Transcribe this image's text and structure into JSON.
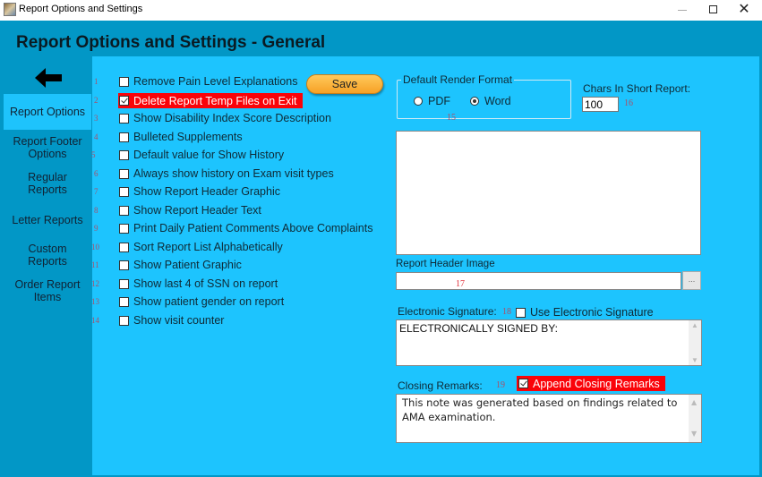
{
  "window": {
    "title": "Report Options and Settings",
    "controls": {
      "minimize": "—",
      "maximize": "□",
      "close": "✕"
    }
  },
  "header": {
    "title": "Report Options and Settings - General",
    "back_icon": "arrow-left-icon"
  },
  "sidebar": {
    "items": [
      {
        "label": "Report Options",
        "active": true
      },
      {
        "label": "Report Footer Options",
        "active": false
      },
      {
        "label": "Regular Reports",
        "active": false
      },
      {
        "label": "Letter Reports",
        "active": false
      },
      {
        "label": "Custom Reports",
        "active": false
      },
      {
        "label": "Order Report Items",
        "active": false
      }
    ]
  },
  "options": [
    {
      "num": "1",
      "label": "Remove Pain Level Explanations",
      "checked": false,
      "highlight": false
    },
    {
      "num": "2",
      "label": "Delete Report Temp Files on Exit",
      "checked": true,
      "highlight": true
    },
    {
      "num": "3",
      "label": "Show Disability Index Score Description",
      "checked": false,
      "highlight": false
    },
    {
      "num": "4",
      "label": "Bulleted Supplements",
      "checked": false,
      "highlight": false
    },
    {
      "num": "5",
      "label": "Default value for Show History",
      "checked": false,
      "highlight": false
    },
    {
      "num": "6",
      "label": "Always show history on Exam visit types",
      "checked": false,
      "highlight": false
    },
    {
      "num": "7",
      "label": "Show Report Header Graphic",
      "checked": false,
      "highlight": false
    },
    {
      "num": "8",
      "label": "Show Report Header Text",
      "checked": false,
      "highlight": false
    },
    {
      "num": "9",
      "label": "Print Daily Patient Comments Above Complaints",
      "checked": false,
      "highlight": false
    },
    {
      "num": "10",
      "label": "Sort Report List Alphabetically",
      "checked": false,
      "highlight": false
    },
    {
      "num": "11",
      "label": "Show Patient Graphic",
      "checked": false,
      "highlight": false
    },
    {
      "num": "12",
      "label": "Show last 4 of SSN on report",
      "checked": false,
      "highlight": false
    },
    {
      "num": "13",
      "label": "Show patient gender on report",
      "checked": false,
      "highlight": false
    },
    {
      "num": "14",
      "label": "Show visit counter",
      "checked": false,
      "highlight": false
    }
  ],
  "save_button": {
    "label": "Save"
  },
  "render_format": {
    "legend": "Default Render Format",
    "num": "15",
    "options": [
      {
        "label": "PDF",
        "selected": false
      },
      {
        "label": "Word",
        "selected": true
      }
    ]
  },
  "chars_short_report": {
    "label": "Chars In Short Report:",
    "value": "100",
    "num": "16"
  },
  "report_header_image": {
    "label": "Report Header Image",
    "value": "",
    "num": "17",
    "browse_label": "..."
  },
  "electronic_signature": {
    "label": "Electronic Signature:",
    "num": "18",
    "checkbox_label": "Use Electronic Signature",
    "checked": false,
    "text": "ELECTRONICALLY SIGNED BY:"
  },
  "closing_remarks": {
    "label": "Closing Remarks:",
    "num": "19",
    "checkbox_label": "Append Closing Remarks",
    "checked": true,
    "text": "This note was generated based on findings related to AMA examination."
  },
  "colors": {
    "outer_bg": "#0297c6",
    "content_bg": "#1dc4fe",
    "highlight_red": "#fa0309",
    "save_orange": "#f7a226"
  }
}
